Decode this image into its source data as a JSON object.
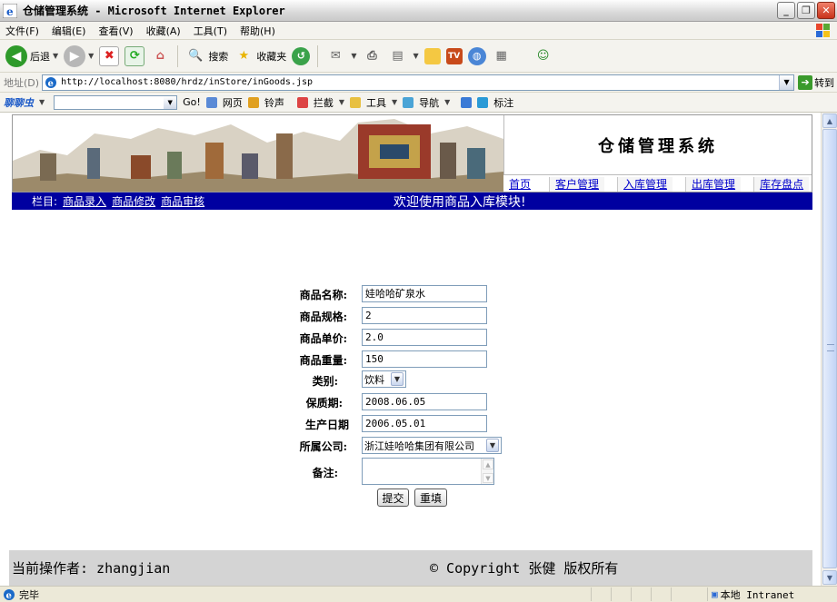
{
  "window": {
    "title": "仓储管理系统 - Microsoft Internet Explorer"
  },
  "menubar": {
    "items": [
      "文件(F)",
      "编辑(E)",
      "查看(V)",
      "收藏(A)",
      "工具(T)",
      "帮助(H)"
    ]
  },
  "toolbar": {
    "back_label": "后退",
    "search_label": "搜索",
    "favorites_label": "收藏夹"
  },
  "addressbar": {
    "label": "地址(D)",
    "url": "http://localhost:8080/hrdz/inStore/inGoods.jsp",
    "go_label": "转到"
  },
  "bar3": {
    "brand": "聊聊虫",
    "go": "Go!",
    "web": "网页",
    "ring": "铃声",
    "block": "拦截",
    "tools": "工具",
    "nav": "导航",
    "mark": "标注"
  },
  "page": {
    "system_name": "仓储管理系统",
    "nav": [
      "首页",
      "客户管理",
      "入库管理",
      "出库管理",
      "库存盘点"
    ],
    "column_label": "栏目:",
    "column_links": [
      "商品录入",
      "商品修改",
      "商品审核"
    ],
    "welcome": "欢迎使用商品入库模块!"
  },
  "form": {
    "name_label": "商品名称:",
    "name_value": "娃哈哈矿泉水",
    "spec_label": "商品规格:",
    "spec_value": "2",
    "price_label": "商品单价:",
    "price_value": "2.0",
    "weight_label": "商品重量:",
    "weight_value": "150",
    "category_label": "类别:",
    "category_value": "饮料",
    "shelf_label": "保质期:",
    "shelf_value": "2008.06.05",
    "produce_label": "生产日期",
    "produce_value": "2006.05.01",
    "company_label": "所属公司:",
    "company_value": "浙江娃哈哈集团有限公司",
    "remark_label": "备注:",
    "submit_label": "提交",
    "reset_label": "重填"
  },
  "footer": {
    "operator": "当前操作者: zhangjian",
    "copyright": "© Copyright 张健 版权所有"
  },
  "statusbar": {
    "status": "完毕",
    "zone": "本地 Intranet"
  },
  "colors": {
    "blue_bar": "#0000a0",
    "link": "#0000cc",
    "footer_bg": "#d4d4d4"
  }
}
